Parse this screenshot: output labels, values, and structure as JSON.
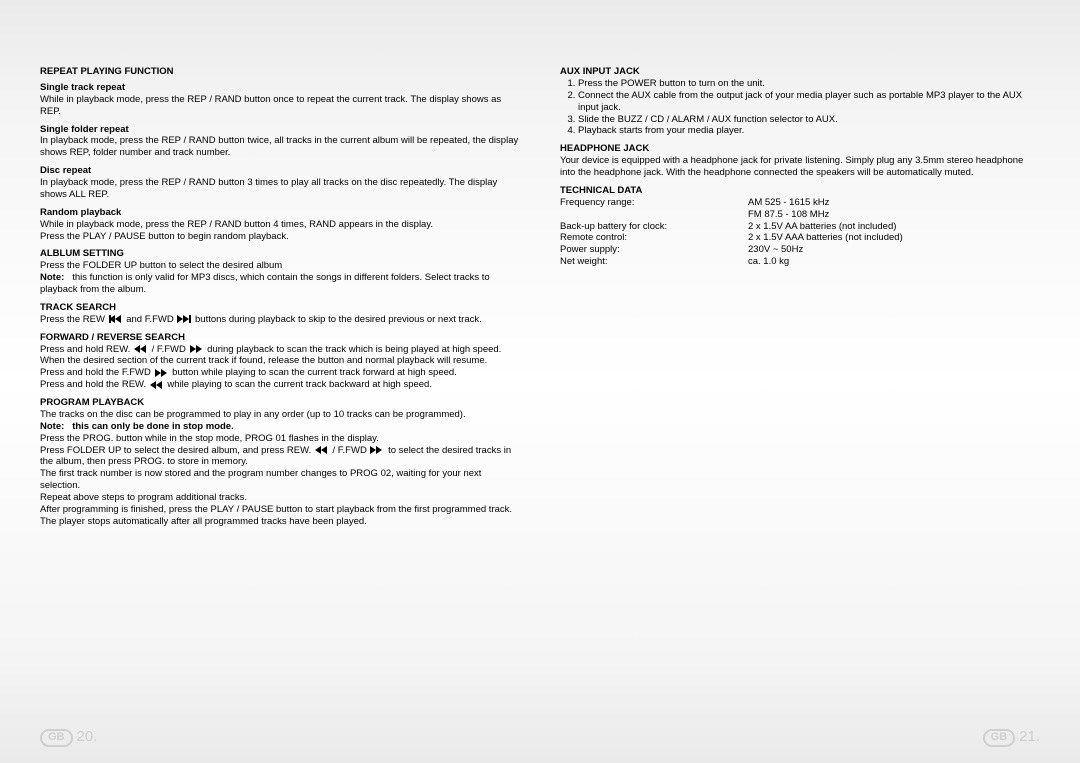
{
  "left": {
    "h1": "REPEAT PLAYING FUNCTION",
    "s1h": "Single track repeat",
    "s1": "While in playback mode, press the REP / RAND button once to repeat the current track. The display shows as REP.",
    "s2h": "Single folder repeat",
    "s2": "In playback mode, press the REP / RAND button twice, all tracks in the current album will be repeated, the display shows REP, folder number and track number.",
    "s3h": "Disc repeat",
    "s3": "In playback mode, press the REP / RAND button 3 times to play all tracks on the disc repeatedly. The display shows ALL REP.",
    "s4h": "Random playback",
    "s4a": "While in playback mode, press the REP / RAND button 4 times, RAND appears in the display.",
    "s4b": "Press the PLAY / PAUSE button to begin random playback.",
    "h2": "ALBLUM SETTING",
    "al1": "Press the FOLDER UP button to select the desired album",
    "alNoteLabel": "Note:",
    "alNote": "this function is only valid for MP3 discs, which contain the songs in different folders. Select tracks to playback from the album.",
    "h3": "TRACK SEARCH",
    "tsPre": "Press the REW ",
    "tsMid": " and F.FWD ",
    "tsPost": " buttons during playback to skip to the desired previous or next track.",
    "h4": "FORWARD / REVERSE SEARCH",
    "fr1a": "Press and hold REW. ",
    "fr1b": " / F.FWD ",
    "fr1c": " during playback to scan the track which is being played at high speed. When the desired section of the current track if found, release the button and normal playback will resume.",
    "fr2a": "Press and hold the F.FWD ",
    "fr2b": " button while playing to scan the current track forward at high speed.",
    "fr3a": "Press and hold the REW. ",
    "fr3b": " while playing to scan the current track backward at high speed.",
    "h5": "PROGRAM PLAYBACK",
    "pp1": "The tracks on the disc can be programmed to play in any order (up to 10 tracks can be programmed).",
    "ppNoteLabel": "Note:",
    "ppNote": "this can only be done in stop mode.",
    "pp2": "Press the PROG. button while in the stop mode, PROG 01 flashes in the display.",
    "pp3a": "Press FOLDER UP to select the desired album, and press REW. ",
    "pp3b": " / F.FWD ",
    "pp3c": " to select the desired tracks in the album, then press PROG. to store in memory.",
    "pp4": "The first track number is now stored and the program number changes to PROG 02, waiting for your next selection.",
    "pp5": "Repeat above steps to program additional tracks.",
    "pp6": "After programming is finished, press the PLAY / PAUSE button to start playback from the first programmed track. The player stops automatically after all programmed tracks have been played."
  },
  "right": {
    "h1": "AUX INPUT JACK",
    "aux1": "Press the POWER button to turn on the unit.",
    "aux2": "Connect the AUX cable from the output jack of your media player such as portable MP3 player to the AUX input jack.",
    "aux3": "Slide the BUZZ / CD / ALARM / AUX function selector to AUX.",
    "aux4": "Playback starts from your media player.",
    "h2": "HEADPHONE JACK",
    "hp": "Your device is equipped with a headphone jack for private listening. Simply plug any 3.5mm stereo headphone into the headphone jack. With the headphone connected the speakers will be automatically muted.",
    "h3": "TECHNICAL DATA",
    "tdFreqLabel": "Frequency range:",
    "tdFreqAM": "AM 525 - 1615 kHz",
    "tdFreqFM": "FM 87.5 - 108 MHz",
    "tdBattLabel": "Back-up battery for clock:",
    "tdBattVal": "2 x 1.5V AA batteries (not included)",
    "tdRemoteLabel": "Remote control:",
    "tdRemoteVal": "2 x 1.5V AAA batteries (not included)",
    "tdPowerLabel": "Power supply:",
    "tdPowerVal": "230V ~ 50Hz",
    "tdWeightLabel": "Net weight:",
    "tdWeightVal": "ca. 1.0 kg"
  },
  "footer": {
    "gb": "GB",
    "pLeft": "20.",
    "pRight": "21."
  }
}
